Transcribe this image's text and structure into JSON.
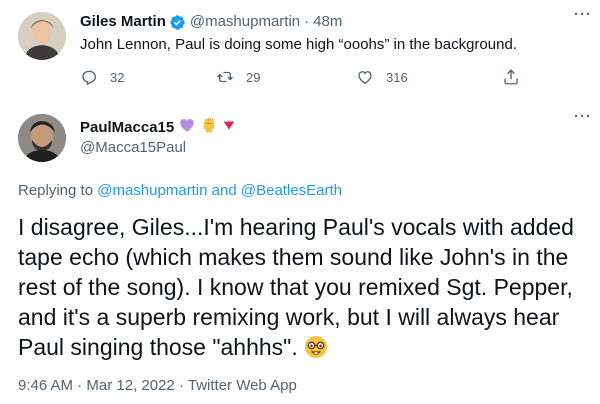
{
  "tweet1": {
    "name": "Giles Martin",
    "handle": "@mashupmartin",
    "separator": "·",
    "time": "48m",
    "text": "John Lennon, Paul is doing some high “ooohs” in the background.",
    "replies": "32",
    "retweets": "29",
    "likes": "316",
    "more": "···"
  },
  "tweet2": {
    "name": "PaulMacca15",
    "handle": "@Macca15Paul",
    "more": "···",
    "replying_prefix": "Replying to ",
    "replying_user1": "@mashupmartin",
    "replying_and": " and ",
    "replying_user2": "@BeatlesEarth",
    "body_lines": [
      "I disagree, Giles...I'm hearing Paul's vocals with added",
      "tape echo (which makes them sound like John's in the",
      "rest of the song). I know that you remixed Sgt. Pepper,",
      "and it's a superb remixing work, but I will always hear",
      "Paul singing those \"ahhhs\"."
    ],
    "time": "9:46 AM",
    "separator": "·",
    "date": "Mar 12, 2022",
    "source": "Twitter Web App"
  },
  "colors": {
    "accent": "#1d9bf0",
    "muted": "#536471",
    "text": "#0f1419",
    "heart_emoji": "#b48ce6",
    "fist_emoji": "#f6c342",
    "triangle_emoji": "#e0245e"
  },
  "icons": [
    "verified-badge-icon",
    "reply-icon",
    "retweet-icon",
    "like-icon",
    "share-icon",
    "purple-heart-icon",
    "raised-fist-icon",
    "red-triangle-icon",
    "nerd-face-icon"
  ]
}
